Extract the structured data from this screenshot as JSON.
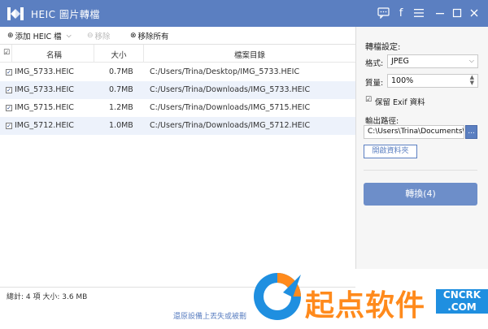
{
  "title_bar": {
    "app_title": "HEIC 圖片轉檔",
    "icons": [
      "chat-icon",
      "facebook-icon",
      "menu-icon",
      "minimize-icon",
      "maximize-icon",
      "close-icon"
    ],
    "bg_color": "#5b7fc1"
  },
  "toolbar": {
    "add_label": "添加 HEIC 檔",
    "remove_label": "移除",
    "remove_all_label": "移除所有"
  },
  "table": {
    "headers": [
      "名稱",
      "大小",
      "檔案目錄"
    ],
    "rows": [
      {
        "name": "IMG_5733.HEIC",
        "size": "0.7MB",
        "path": "C:/Users/Trina/Desktop/IMG_5733.HEIC"
      },
      {
        "name": "IMG_5733.HEIC",
        "size": "0.7MB",
        "path": "C:/Users/Trina/Downloads/IMG_5733.HEIC"
      },
      {
        "name": "IMG_5715.HEIC",
        "size": "1.2MB",
        "path": "C:/Users/Trina/Downloads/IMG_5715.HEIC"
      },
      {
        "name": "IMG_5712.HEIC",
        "size": "1.0MB",
        "path": "C:/Users/Trina/Downloads/IMG_5712.HEIC"
      }
    ]
  },
  "settings": {
    "heading": "轉檔設定:",
    "format_label": "格式:",
    "format_value": "JPEG",
    "quality_label": "質量:",
    "quality_value": "100%",
    "keep_exif_label": "保留 Exif 資料",
    "output_label": "輸出路徑:",
    "output_value": "C:\\Users\\Trina\\Documents\\",
    "browse_label": "...",
    "open_folder_label": "開啟資料夾",
    "convert_label": "轉換(4)"
  },
  "status": {
    "summary": "總計: 4 項 大小: 3.6 MB",
    "footer_link": "還原設備上丟失或被刪"
  },
  "watermark": {
    "text": "起点软件",
    "domain_line1": "CNCRK",
    "domain_line2": ".COM"
  }
}
